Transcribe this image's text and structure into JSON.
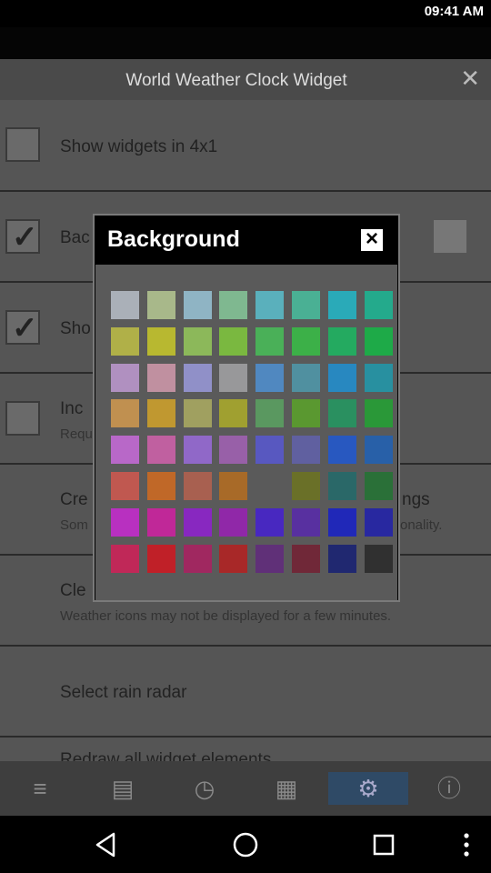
{
  "status_bar": {
    "time": "09:41 AM"
  },
  "app": {
    "title": "World Weather Clock Widget",
    "rows": [
      {
        "label": "Show widgets in 4x1",
        "checked": false
      },
      {
        "label": "Bac",
        "checked": true
      },
      {
        "label": "Sho",
        "checked": true
      },
      {
        "label": "Inc",
        "sub": "Requ",
        "checked": false
      },
      {
        "label": "Cre",
        "label_right": "ngs",
        "sub": "Som",
        "sub_right": "onality."
      },
      {
        "label": "Cle",
        "sub": "Weather icons may not be displayed for a few minutes."
      },
      {
        "label": "Select rain radar"
      },
      {
        "label": "Redraw all widget elements"
      }
    ]
  },
  "dialog": {
    "title": "Background",
    "close_icon": "close-icon",
    "swatches": [
      [
        "#aab0b8",
        "#a8b88a",
        "#8fb4c4",
        "#7fb890",
        "#5ab0bc",
        "#4ab094",
        "#2aaab8",
        "#24aa8c"
      ],
      [
        "#b0b048",
        "#b8b830",
        "#8cb85a",
        "#7ab840",
        "#4ab058",
        "#3cb048",
        "#24aa60",
        "#1eaa48"
      ],
      [
        "#b090c0",
        "#c090a0",
        "#9090c8",
        "#98989a",
        "#5088c0",
        "#5090a0",
        "#2888c0",
        "#2890a0"
      ],
      [
        "#c09050",
        "#c09830",
        "#a0a060",
        "#a0a030",
        "#5a9860",
        "#5a9830",
        "#2a9060",
        "#2a9838"
      ],
      [
        "#b868c8",
        "#c060a0",
        "#9068c8",
        "#9860a8",
        "#5858c0",
        "#6060a0",
        "#2858c0",
        "#2860a8"
      ],
      [
        "#c05850",
        "#c06828",
        "#a86050",
        "#a86a28",
        "#5a5a5a",
        "#6a7028",
        "#2a6868",
        "#2a7038"
      ],
      [
        "#b830c0",
        "#c02898",
        "#8828c0",
        "#9028a8",
        "#4828c0",
        "#5830a0",
        "#2028b8",
        "#2828a0"
      ],
      [
        "#c02858",
        "#c02028",
        "#a02860",
        "#a82828",
        "#603078",
        "#702838",
        "#202870",
        "#303030"
      ]
    ]
  },
  "bottom_bar": {
    "icons": [
      "menu-icon",
      "image-icon",
      "alarm-icon",
      "basket-icon",
      "gear-icon",
      "info-icon"
    ]
  },
  "system_nav": [
    "back-icon",
    "home-icon",
    "recents-icon",
    "more-icon"
  ]
}
